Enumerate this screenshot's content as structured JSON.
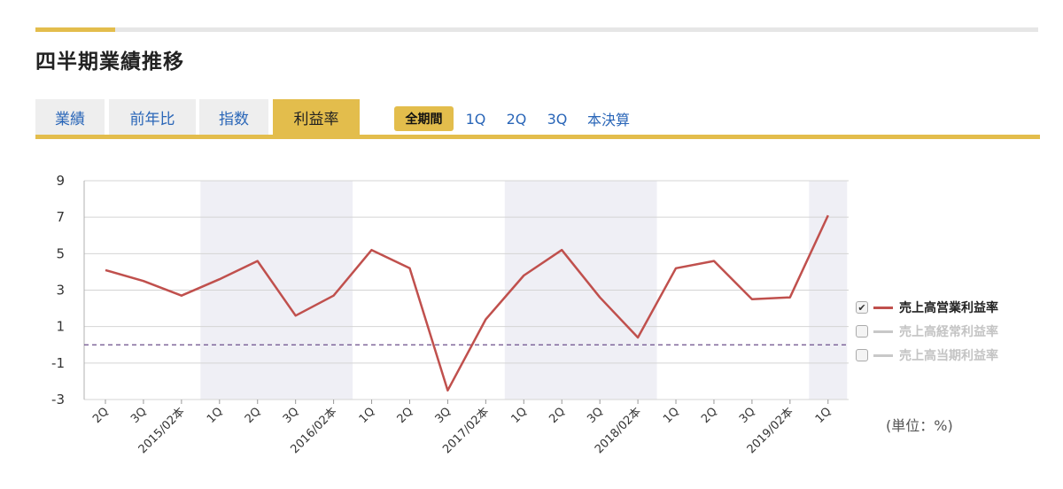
{
  "section": {
    "title": "四半期業績推移"
  },
  "tabs": [
    {
      "label": "業績",
      "active": false
    },
    {
      "label": "前年比",
      "active": false
    },
    {
      "label": "指数",
      "active": false
    },
    {
      "label": "利益率",
      "active": true
    }
  ],
  "period_filters": [
    {
      "label": "全期間",
      "active": true
    },
    {
      "label": "1Q",
      "active": false
    },
    {
      "label": "2Q",
      "active": false
    },
    {
      "label": "3Q",
      "active": false
    },
    {
      "label": "本決算",
      "active": false
    }
  ],
  "legend": [
    {
      "label": "売上高営業利益率",
      "checked": true,
      "color": "#c0504d"
    },
    {
      "label": "売上高経常利益率",
      "checked": false,
      "color": "#c8c8c8"
    },
    {
      "label": "売上高当期利益率",
      "checked": false,
      "color": "#c8c8c8"
    }
  ],
  "unit_label": "(単位：%)",
  "colors": {
    "accent": "#e3bd4c",
    "link": "#2a66b8",
    "series": "#c0504d",
    "zero_line": "#6b4e8a",
    "band": "#efeff5"
  },
  "chart_data": {
    "type": "line",
    "categories": [
      "2Q",
      "3Q",
      "2015/02本",
      "1Q",
      "2Q",
      "3Q",
      "2016/02本",
      "1Q",
      "2Q",
      "3Q",
      "2017/02本",
      "1Q",
      "2Q",
      "3Q",
      "2018/02本",
      "1Q",
      "2Q",
      "3Q",
      "2019/02本",
      "1Q"
    ],
    "series": [
      {
        "name": "売上高営業利益率",
        "values": [
          4.1,
          3.5,
          2.7,
          3.6,
          4.6,
          1.6,
          2.7,
          5.2,
          4.2,
          -2.5,
          1.4,
          3.8,
          5.2,
          2.6,
          0.4,
          4.2,
          4.6,
          2.5,
          2.6,
          7.1
        ]
      }
    ],
    "yticks": [
      9,
      7,
      5,
      3,
      1,
      -1,
      -3
    ],
    "ylim": [
      -3,
      9
    ],
    "reference_line": 0,
    "shaded_fiscal_years": [
      1,
      3,
      5
    ],
    "grid": true
  }
}
